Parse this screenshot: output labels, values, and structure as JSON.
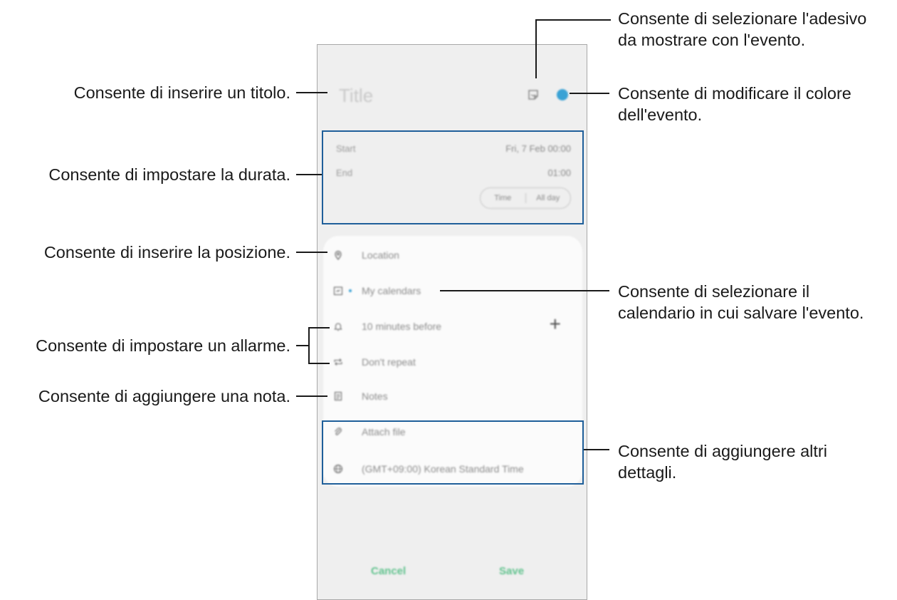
{
  "phone": {
    "title_placeholder": "Title",
    "start_label": "Start",
    "start_value": "Fri, 7 Feb 00:00",
    "end_label": "End",
    "end_value": "01:00",
    "toggle_time": "Time",
    "toggle_allday": "All day",
    "location": "Location",
    "calendar": "My calendars",
    "alarm": "10 minutes before",
    "repeat": "Don't repeat",
    "notes": "Notes",
    "attach": "Attach file",
    "timezone": "(GMT+09:00) Korean Standard Time",
    "cancel": "Cancel",
    "save": "Save",
    "event_color": "#3aa2d5",
    "button_color": "#60c28d",
    "icons": [
      "sticker-icon",
      "location-pin-icon",
      "calendar-icon",
      "bell-icon",
      "repeat-icon",
      "notes-icon",
      "paperclip-icon",
      "globe-icon",
      "plus-icon"
    ]
  },
  "annotations": {
    "sticker_1": "Consente di selezionare l'adesivo",
    "sticker_2": "da mostrare con l'evento.",
    "title": "Consente di inserire un titolo.",
    "color_1": "Consente di modificare il colore",
    "color_2": "dell'evento.",
    "duration": "Consente di impostare la durata.",
    "location": "Consente di inserire la posizione.",
    "calendar_1": "Consente di selezionare il",
    "calendar_2": "calendario in cui salvare l'evento.",
    "alarm": "Consente di impostare un allarme.",
    "note": "Consente di aggiungere una nota.",
    "details_1": "Consente di aggiungere altri",
    "details_2": "dettagli."
  }
}
